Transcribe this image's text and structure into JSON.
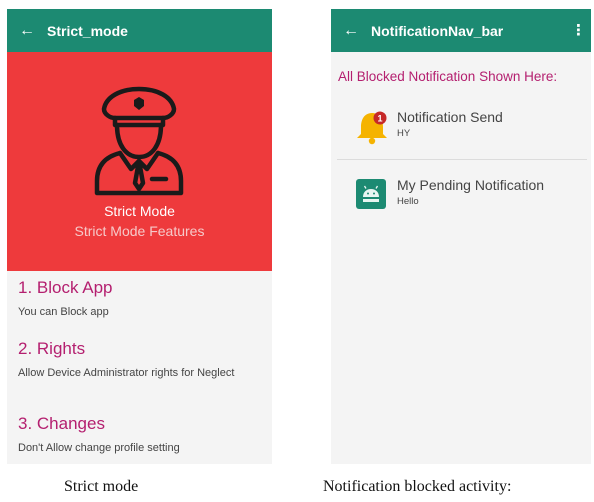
{
  "left_screen": {
    "app_bar": {
      "title": "Strict_mode",
      "back_icon": "arrow-left-icon"
    },
    "hero": {
      "background": "#ee3a3c",
      "icon": "police-officer-icon",
      "title": "Strict Mode",
      "subtitle": "Strict Mode Features"
    },
    "features": [
      {
        "title": "1. Block App",
        "description": "You can Block app"
      },
      {
        "title": "2. Rights",
        "description": "Allow Device Administrator rights for Neglect"
      },
      {
        "title": "3. Changes",
        "description": "Don't Allow change profile setting"
      }
    ]
  },
  "right_screen": {
    "app_bar": {
      "title": "NotificationNav_bar",
      "back_icon": "arrow-left-icon",
      "menu_icon": "more-vert-icon"
    },
    "header": "All Blocked Notification Shown Here:",
    "notifications": [
      {
        "title": "Notification Send",
        "body": "HY",
        "icon": "bell-icon",
        "badge": "1"
      },
      {
        "title": "My Pending Notification",
        "body": "Hello",
        "icon": "android-icon"
      }
    ]
  },
  "captions": {
    "left": "Strict mode",
    "right": "Notification blocked activity:"
  },
  "colors": {
    "app_bar": "#1c8a72",
    "accent_text": "#b41f6f",
    "hero": "#ee3a3c"
  }
}
